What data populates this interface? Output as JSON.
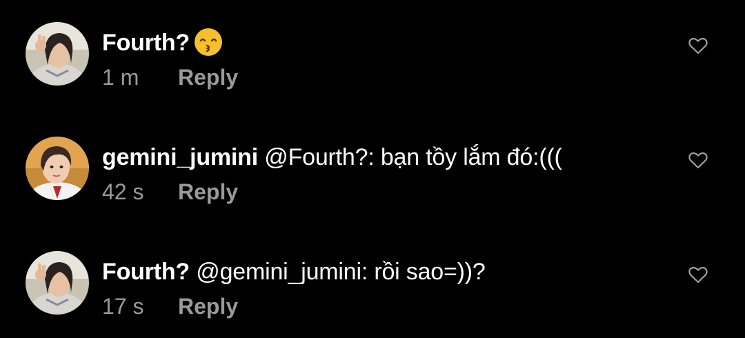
{
  "comments": [
    {
      "username": "Fourth?",
      "mention": "",
      "text": "",
      "emoji": "kissing-face-with-smiling-eyes",
      "time": "1 m",
      "reply_label": "Reply",
      "like_icon": "heart-outline-icon"
    },
    {
      "username": "gemini_jumini",
      "mention": "@Fourth?:",
      "text": "bạn tồy lắm đó:(((",
      "emoji": "",
      "time": "42 s",
      "reply_label": "Reply",
      "like_icon": "heart-outline-icon"
    },
    {
      "username": "Fourth?",
      "mention": "@gemini_jumini:",
      "text": "rồi sao=))?",
      "emoji": "",
      "time": "17 s",
      "reply_label": "Reply",
      "like_icon": "heart-outline-icon"
    }
  ],
  "colors": {
    "background": "#000000",
    "primary_text": "#ffffff",
    "secondary_text": "#9a9a9a",
    "emoji_yellow": "#f7c02b"
  }
}
